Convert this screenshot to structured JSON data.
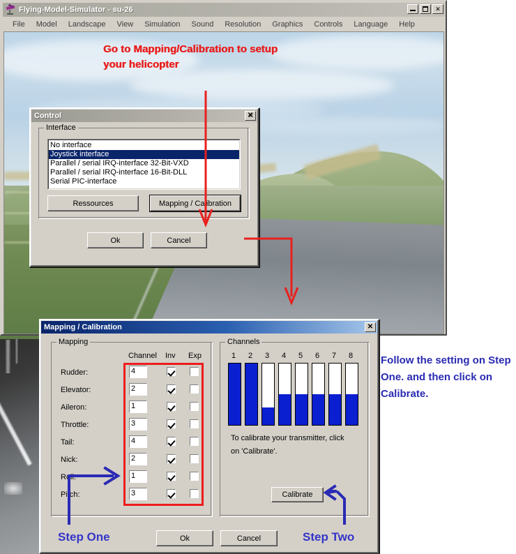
{
  "app": {
    "title": "Flying-Model-Simulator - su-26",
    "icon": "airplane-icon",
    "titlebar_buttons": [
      {
        "name": "minimize-button",
        "glyph": "_"
      },
      {
        "name": "maximize-button",
        "glyph": "□"
      },
      {
        "name": "close-button",
        "glyph": "✕"
      }
    ],
    "menu": [
      "File",
      "Model",
      "Landscape",
      "View",
      "Simulation",
      "Sound",
      "Resolution",
      "Graphics",
      "Controls",
      "Language",
      "Help"
    ]
  },
  "control_dialog": {
    "title": "Control",
    "close_glyph": "✕",
    "group_label": "Interface",
    "interfaces": [
      {
        "label": "No interface",
        "selected": false
      },
      {
        "label": "Joystick interface",
        "selected": true
      },
      {
        "label": "Parallel / serial IRQ-interface 32-Bit-VXD",
        "selected": false
      },
      {
        "label": "Parallel / serial IRQ-interface 16-Bit-DLL",
        "selected": false
      },
      {
        "label": "Serial PIC-interface",
        "selected": false
      }
    ],
    "ressources_label": "Ressources",
    "mapping_calibration_label": "Mapping / Calibration",
    "ok_label": "Ok",
    "cancel_label": "Cancel"
  },
  "mapping_dialog": {
    "title": "Mapping / Calibration",
    "close_glyph": "✕",
    "mapping_group_label": "Mapping",
    "channels_group_label": "Channels",
    "column_headers": [
      "Channel",
      "Inv",
      "Exp"
    ],
    "rows": [
      {
        "label": "Rudder:",
        "channel": "4",
        "inv": true,
        "exp": false
      },
      {
        "label": "Elevator:",
        "channel": "2",
        "inv": true,
        "exp": false
      },
      {
        "label": "Aileron:",
        "channel": "1",
        "inv": true,
        "exp": false
      },
      {
        "label": "Throttle:",
        "channel": "3",
        "inv": true,
        "exp": false
      },
      {
        "label": "Tail:",
        "channel": "4",
        "inv": true,
        "exp": false
      },
      {
        "label": "Nick:",
        "channel": "2",
        "inv": true,
        "exp": false
      },
      {
        "label": "Roll:",
        "channel": "1",
        "inv": true,
        "exp": false
      },
      {
        "label": "Pitch:",
        "channel": "3",
        "inv": true,
        "exp": false
      }
    ],
    "channel_numbers": [
      "1",
      "2",
      "3",
      "4",
      "5",
      "6",
      "7",
      "8"
    ],
    "channel_levels": [
      100,
      100,
      28,
      50,
      50,
      50,
      50,
      50
    ],
    "hint_line1": "To calibrate your transmitter, click",
    "hint_line2": "on 'Calibrate'.",
    "calibrate_label": "Calibrate",
    "ok_label": "Ok",
    "cancel_label": "Cancel"
  },
  "annotations": {
    "red_top_line1": "Go to Mapping/Calibration to setup",
    "red_top_line2": "your helicopter",
    "blue_right_line1": "Follow the setting on Step",
    "blue_right_line2": "One. and then click on",
    "blue_right_line3": "Calibrate.",
    "step_one": "Step One",
    "step_two": "Step Two",
    "red_color": "#e8201e",
    "blue_color": "#2a2ab4",
    "highlight_box_color": "#ec1c1c"
  }
}
